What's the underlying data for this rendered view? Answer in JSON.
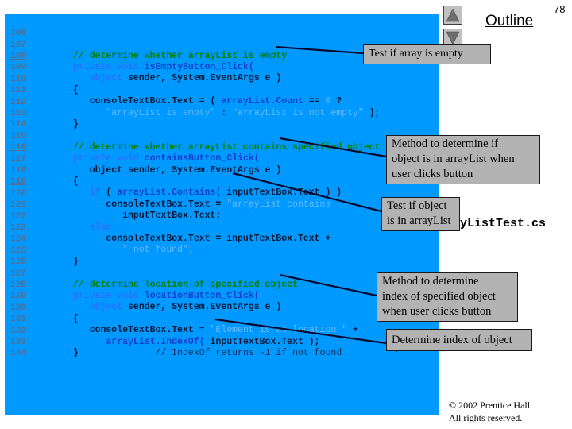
{
  "slide": {
    "page_number": "78",
    "outline_label": "Outline",
    "filename": "ArrayListTest.cs",
    "copyright_line1": "© 2002 Prentice Hall.",
    "copyright_line2": "All rights reserved."
  },
  "nav": {
    "up_icon": "triangle-up",
    "down_icon": "triangle-down"
  },
  "code": {
    "lines": [
      {
        "num": "106",
        "text": ""
      },
      {
        "num": "107",
        "text": "// determine whether arrayList is empty"
      },
      {
        "num": "108",
        "text": "private void isEmptyButton_Click("
      },
      {
        "num": "109",
        "text": "   object sender, System.EventArgs e )"
      },
      {
        "num": "110",
        "text": "{"
      },
      {
        "num": "111",
        "text": "   consoleTextBox.Text = ( arrayList.Count == 0 ?"
      },
      {
        "num": "112",
        "text": "      \"arrayList is empty\" : \"arrayList is not empty\" );"
      },
      {
        "num": "113",
        "text": "}"
      },
      {
        "num": "114",
        "text": ""
      },
      {
        "num": "115",
        "text": "// determine whether arrayList contains specified object"
      },
      {
        "num": "116",
        "text": "private void containsButton_Click("
      },
      {
        "num": "117",
        "text": "   object sender, System.EventArgs e )"
      },
      {
        "num": "118",
        "text": "{"
      },
      {
        "num": "119",
        "text": "   if ( arrayList.Contains( inputTextBox.Text ) )"
      },
      {
        "num": "120",
        "text": "      consoleTextBox.Text = \"arrayList contains \" +"
      },
      {
        "num": "121",
        "text": "         inputTextBox.Text;"
      },
      {
        "num": "122",
        "text": "   else"
      },
      {
        "num": "123",
        "text": "      consoleTextBox.Text = inputTextBox.Text +"
      },
      {
        "num": "124",
        "text": "         \" not found\";"
      },
      {
        "num": "125",
        "text": "}"
      },
      {
        "num": "126",
        "text": ""
      },
      {
        "num": "127",
        "text": "// determine location of specified object"
      },
      {
        "num": "128",
        "text": "private void locationButton_Click("
      },
      {
        "num": "129",
        "text": "   object sender, System.EventArgs e )"
      },
      {
        "num": "130",
        "text": "{"
      },
      {
        "num": "131",
        "text": "   consoleTextBox.Text = \"Element is at location \" +"
      },
      {
        "num": "132",
        "text": "      arrayList.IndexOf( inputTextBox.Text );"
      },
      {
        "num": "133",
        "text": "}              // IndexOf returns -1 if not found"
      },
      {
        "num": "134",
        "text": ""
      }
    ]
  },
  "callouts": [
    {
      "id": "test-empty",
      "text": "Test if array is empty"
    },
    {
      "id": "contains-method",
      "text": "Method to determine if\nobject is in arrayList when\nuser clicks button"
    },
    {
      "id": "test-object",
      "text": "Test if object\nis in arrayList"
    },
    {
      "id": "location-method",
      "text": "Method to determine\nindex of specified object\nwhen user clicks button"
    },
    {
      "id": "determine-index",
      "text": "Determine index of object"
    }
  ],
  "colors": {
    "code_background": "#0099ff",
    "comment": "#008000",
    "keyword": "#3366ff",
    "string": "#66b8ff",
    "callout_background": "#b3b3b3"
  }
}
